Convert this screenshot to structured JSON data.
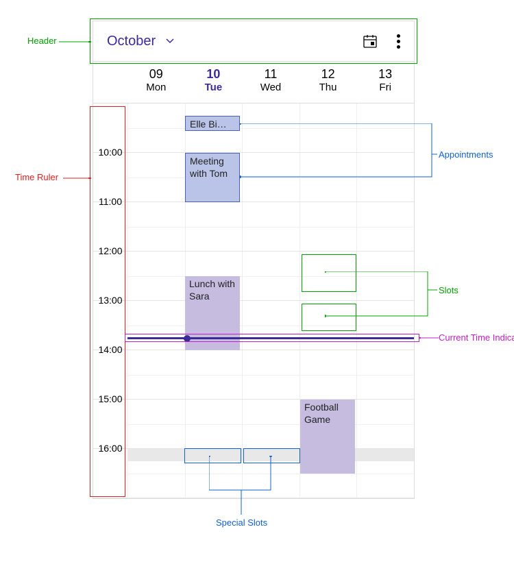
{
  "header": {
    "month_label": "October"
  },
  "days": [
    {
      "num": "09",
      "name": "Mon",
      "today": false
    },
    {
      "num": "10",
      "name": "Tue",
      "today": true
    },
    {
      "num": "11",
      "name": "Wed",
      "today": false
    },
    {
      "num": "12",
      "name": "Thu",
      "today": false
    },
    {
      "num": "13",
      "name": "Fri",
      "today": false
    }
  ],
  "hours": [
    "10:00",
    "11:00",
    "12:00",
    "13:00",
    "14:00",
    "15:00",
    "16:00"
  ],
  "appointments": {
    "elle": "Elle Bi…",
    "meeting": "Meeting with Tom",
    "lunch": "Lunch with Sara",
    "football": "Football Game"
  },
  "annotations": {
    "header": "Header",
    "time_ruler": "Time Ruler",
    "appointments": "Appointments",
    "slots": "Slots",
    "current_time": "Current Time Indicator",
    "special_slots": "Special Slots"
  },
  "colors": {
    "green": "#00a000",
    "red": "#e02020",
    "blue": "#1060d0",
    "magenta": "#c020c0"
  }
}
